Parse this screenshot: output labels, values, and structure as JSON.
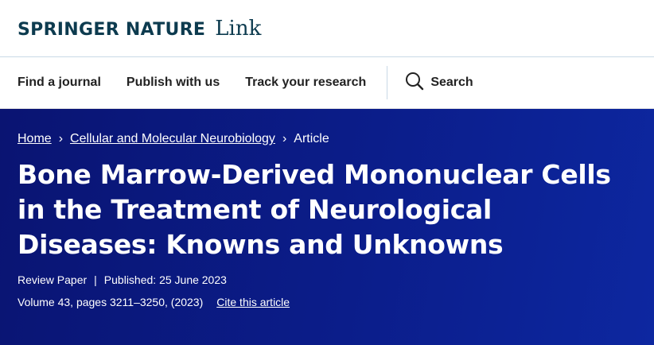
{
  "header": {
    "logo_brand": "SPRINGER NATURE",
    "logo_link": "Link"
  },
  "nav": {
    "items": [
      {
        "label": "Find a journal"
      },
      {
        "label": "Publish with us"
      },
      {
        "label": "Track your research"
      }
    ],
    "search_label": "Search",
    "search_icon": "search-icon"
  },
  "breadcrumb": {
    "items": [
      {
        "label": "Home"
      },
      {
        "label": "Cellular and Molecular Neurobiology"
      }
    ],
    "current": "Article",
    "separator": "›"
  },
  "article": {
    "title": "Bone Marrow-Derived Mononuclear Cells in the Treatment of Neurological Diseases: Knowns and Unknowns",
    "type": "Review Paper",
    "published": "Published: 25 June 2023",
    "volume": "Volume 43, pages 3211–3250, (2023)",
    "cite_label": "Cite this article"
  },
  "colors": {
    "hero_background": "#0b1d8a",
    "logo_color": "#0d3b4f"
  }
}
